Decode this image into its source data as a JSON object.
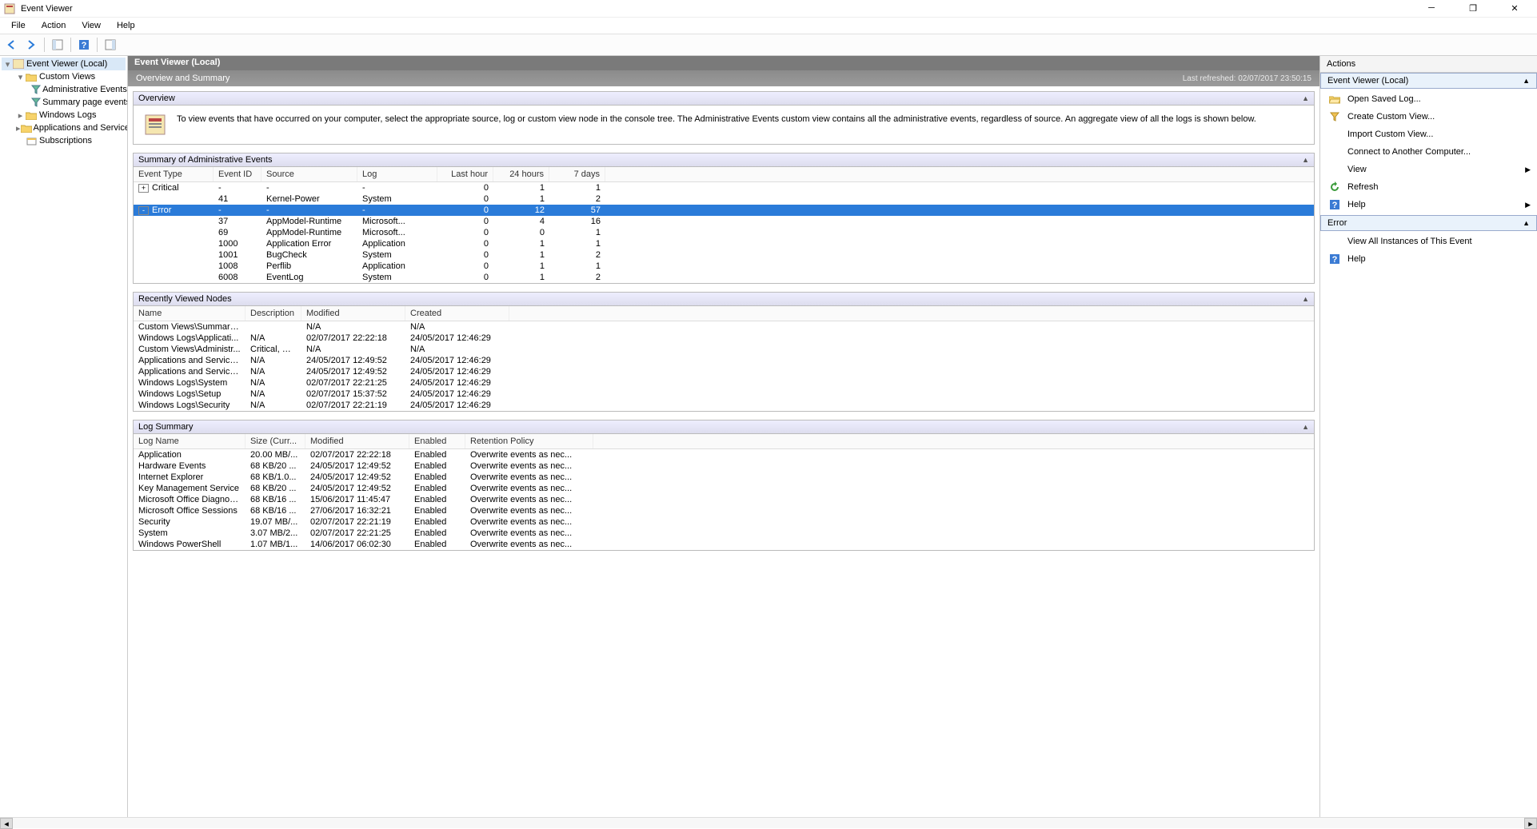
{
  "window": {
    "title": "Event Viewer",
    "min_tip": "Minimize",
    "max_tip": "Restore",
    "close_tip": "Close"
  },
  "menu": {
    "file": "File",
    "action": "Action",
    "view": "View",
    "help": "Help"
  },
  "toolbar": {
    "back": "Back",
    "forward": "Forward",
    "up": "Up",
    "props": "Properties",
    "help": "Help",
    "panel": "Show/Hide Action Pane"
  },
  "tree": {
    "root": "Event Viewer (Local)",
    "custom_views": "Custom Views",
    "admin_events": "Administrative Events",
    "summary_page": "Summary page events",
    "win_logs": "Windows Logs",
    "apps_logs": "Applications and Services Lo",
    "subscriptions": "Subscriptions"
  },
  "center": {
    "header": "Event Viewer (Local)",
    "ov_title": "Overview and Summary",
    "last_refreshed": "Last refreshed: 02/07/2017 23:50:15",
    "overview_head": "Overview",
    "overview_text": "To view events that have occurred on your computer, select the appropriate source, log or custom view node in the console tree. The Administrative Events custom view contains all the administrative events, regardless of source. An aggregate view of all the logs is shown below.",
    "summary_head": "Summary of Administrative Events",
    "recent_head": "Recently Viewed Nodes",
    "logsum_head": "Log Summary"
  },
  "summary": {
    "cols": [
      "Event Type",
      "Event ID",
      "Source",
      "Log",
      "Last hour",
      "24 hours",
      "7 days"
    ],
    "rows": [
      {
        "expander": "+",
        "type": "Critical",
        "id": "-",
        "source": "-",
        "log": "-",
        "h": "0",
        "d": "1",
        "w": "1",
        "sel": false,
        "group": true
      },
      {
        "expander": "",
        "type": "",
        "id": "41",
        "source": "Kernel-Power",
        "log": "System",
        "h": "0",
        "d": "1",
        "w": "2",
        "sel": false
      },
      {
        "expander": "-",
        "type": "Error",
        "id": "-",
        "source": "-",
        "log": "-",
        "h": "0",
        "d": "12",
        "w": "57",
        "sel": true,
        "group": true
      },
      {
        "expander": "",
        "type": "",
        "id": "37",
        "source": "AppModel-Runtime",
        "log": "Microsoft...",
        "h": "0",
        "d": "4",
        "w": "16",
        "sel": false
      },
      {
        "expander": "",
        "type": "",
        "id": "69",
        "source": "AppModel-Runtime",
        "log": "Microsoft...",
        "h": "0",
        "d": "0",
        "w": "1",
        "sel": false
      },
      {
        "expander": "",
        "type": "",
        "id": "1000",
        "source": "Application Error",
        "log": "Application",
        "h": "0",
        "d": "1",
        "w": "1",
        "sel": false
      },
      {
        "expander": "",
        "type": "",
        "id": "1001",
        "source": "BugCheck",
        "log": "System",
        "h": "0",
        "d": "1",
        "w": "2",
        "sel": false
      },
      {
        "expander": "",
        "type": "",
        "id": "1008",
        "source": "Perflib",
        "log": "Application",
        "h": "0",
        "d": "1",
        "w": "1",
        "sel": false
      },
      {
        "expander": "",
        "type": "",
        "id": "6008",
        "source": "EventLog",
        "log": "System",
        "h": "0",
        "d": "1",
        "w": "2",
        "sel": false
      }
    ]
  },
  "recent": {
    "cols": [
      "Name",
      "Description",
      "Modified",
      "Created"
    ],
    "rows": [
      {
        "name": "Custom Views\\Summary...",
        "desc": "",
        "mod": "N/A",
        "created": "N/A"
      },
      {
        "name": "Windows Logs\\Applicati...",
        "desc": "N/A",
        "mod": "02/07/2017 22:22:18",
        "created": "24/05/2017 12:46:29"
      },
      {
        "name": "Custom Views\\Administr...",
        "desc": "Critical, Er...",
        "mod": "N/A",
        "created": "N/A"
      },
      {
        "name": "Applications and Service...",
        "desc": "N/A",
        "mod": "24/05/2017 12:49:52",
        "created": "24/05/2017 12:46:29"
      },
      {
        "name": "Applications and Service...",
        "desc": "N/A",
        "mod": "24/05/2017 12:49:52",
        "created": "24/05/2017 12:46:29"
      },
      {
        "name": "Windows Logs\\System",
        "desc": "N/A",
        "mod": "02/07/2017 22:21:25",
        "created": "24/05/2017 12:46:29"
      },
      {
        "name": "Windows Logs\\Setup",
        "desc": "N/A",
        "mod": "02/07/2017 15:37:52",
        "created": "24/05/2017 12:46:29"
      },
      {
        "name": "Windows Logs\\Security",
        "desc": "N/A",
        "mod": "02/07/2017 22:21:19",
        "created": "24/05/2017 12:46:29"
      }
    ]
  },
  "logsum": {
    "cols": [
      "Log Name",
      "Size (Curr...",
      "Modified",
      "Enabled",
      "Retention Policy"
    ],
    "rows": [
      {
        "name": "Application",
        "size": "20.00 MB/...",
        "mod": "02/07/2017 22:22:18",
        "en": "Enabled",
        "ret": "Overwrite events as nec..."
      },
      {
        "name": "Hardware Events",
        "size": "68 KB/20 ...",
        "mod": "24/05/2017 12:49:52",
        "en": "Enabled",
        "ret": "Overwrite events as nec..."
      },
      {
        "name": "Internet Explorer",
        "size": "68 KB/1.0...",
        "mod": "24/05/2017 12:49:52",
        "en": "Enabled",
        "ret": "Overwrite events as nec..."
      },
      {
        "name": "Key Management Service",
        "size": "68 KB/20 ...",
        "mod": "24/05/2017 12:49:52",
        "en": "Enabled",
        "ret": "Overwrite events as nec..."
      },
      {
        "name": "Microsoft Office Diagnosti...",
        "size": "68 KB/16 ...",
        "mod": "15/06/2017 11:45:47",
        "en": "Enabled",
        "ret": "Overwrite events as nec..."
      },
      {
        "name": "Microsoft Office Sessions",
        "size": "68 KB/16 ...",
        "mod": "27/06/2017 16:32:21",
        "en": "Enabled",
        "ret": "Overwrite events as nec..."
      },
      {
        "name": "Security",
        "size": "19.07 MB/...",
        "mod": "02/07/2017 22:21:19",
        "en": "Enabled",
        "ret": "Overwrite events as nec..."
      },
      {
        "name": "System",
        "size": "3.07 MB/2...",
        "mod": "02/07/2017 22:21:25",
        "en": "Enabled",
        "ret": "Overwrite events as nec..."
      },
      {
        "name": "Windows PowerShell",
        "size": "1.07 MB/1...",
        "mod": "14/06/2017 06:02:30",
        "en": "Enabled",
        "ret": "Overwrite events as nec..."
      }
    ]
  },
  "actions": {
    "title": "Actions",
    "group1": "Event Viewer (Local)",
    "open_saved": "Open Saved Log...",
    "create_custom": "Create Custom View...",
    "import_custom": "Import Custom View...",
    "connect": "Connect to Another Computer...",
    "view": "View",
    "refresh": "Refresh",
    "help": "Help",
    "group2": "Error",
    "view_all": "View All Instances of This Event",
    "help2": "Help"
  }
}
